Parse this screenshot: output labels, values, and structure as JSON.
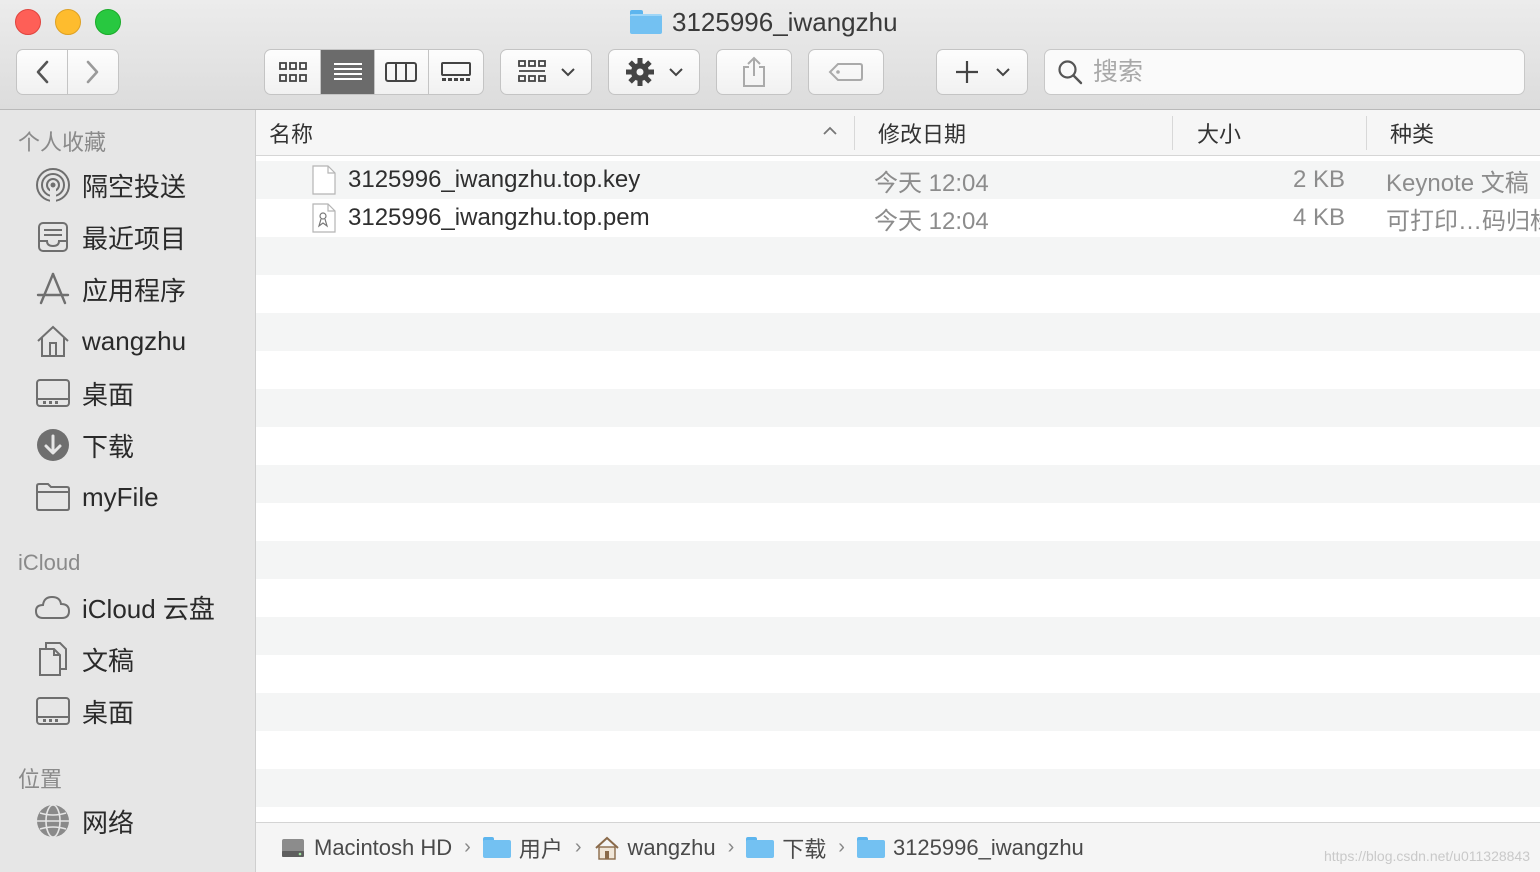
{
  "window": {
    "title": "3125996_iwangzhu"
  },
  "toolbar": {
    "back_icon": "chevron-left-icon",
    "forward_icon": "chevron-right-icon",
    "views": [
      "icon-view",
      "list-view",
      "column-view",
      "gallery-view"
    ],
    "active_view": "list-view",
    "group_icon": "grid-icon",
    "action_icon": "gear-icon",
    "share_icon": "share-icon",
    "tag_icon": "tag-icon",
    "new_icon": "plus-icon"
  },
  "search": {
    "placeholder": "搜索"
  },
  "sidebar": {
    "favorites_heading": "个人收藏",
    "favorites": [
      {
        "label": "隔空投送",
        "icon": "airdrop-icon"
      },
      {
        "label": "最近项目",
        "icon": "recents-icon"
      },
      {
        "label": "应用程序",
        "icon": "applications-icon"
      },
      {
        "label": "wangzhu",
        "icon": "home-icon"
      },
      {
        "label": "桌面",
        "icon": "desktop-icon"
      },
      {
        "label": "下载",
        "icon": "download-icon"
      },
      {
        "label": "myFile",
        "icon": "folder-icon"
      }
    ],
    "icloud_heading": "iCloud",
    "icloud": [
      {
        "label": "iCloud 云盘",
        "icon": "cloud-icon"
      },
      {
        "label": "文稿",
        "icon": "documents-icon"
      },
      {
        "label": "桌面",
        "icon": "desktop-icon"
      }
    ],
    "locations_heading": "位置",
    "locations": [
      {
        "label": "网络",
        "icon": "network-icon"
      }
    ]
  },
  "columns": {
    "name": "名称",
    "date": "修改日期",
    "size": "大小",
    "kind": "种类"
  },
  "files": [
    {
      "name": "3125996_iwangzhu.top.key",
      "date": "今天 12:04",
      "size": "2 KB",
      "kind": "Keynote 文稿"
    },
    {
      "name": "3125996_iwangzhu.top.pem",
      "date": "今天 12:04",
      "size": "4 KB",
      "kind": "可打印…码归档"
    }
  ],
  "pathbar": [
    "Macintosh HD",
    "用户",
    "wangzhu",
    "下载",
    "3125996_iwangzhu"
  ],
  "watermark": "https://blog.csdn.net/u011328843"
}
